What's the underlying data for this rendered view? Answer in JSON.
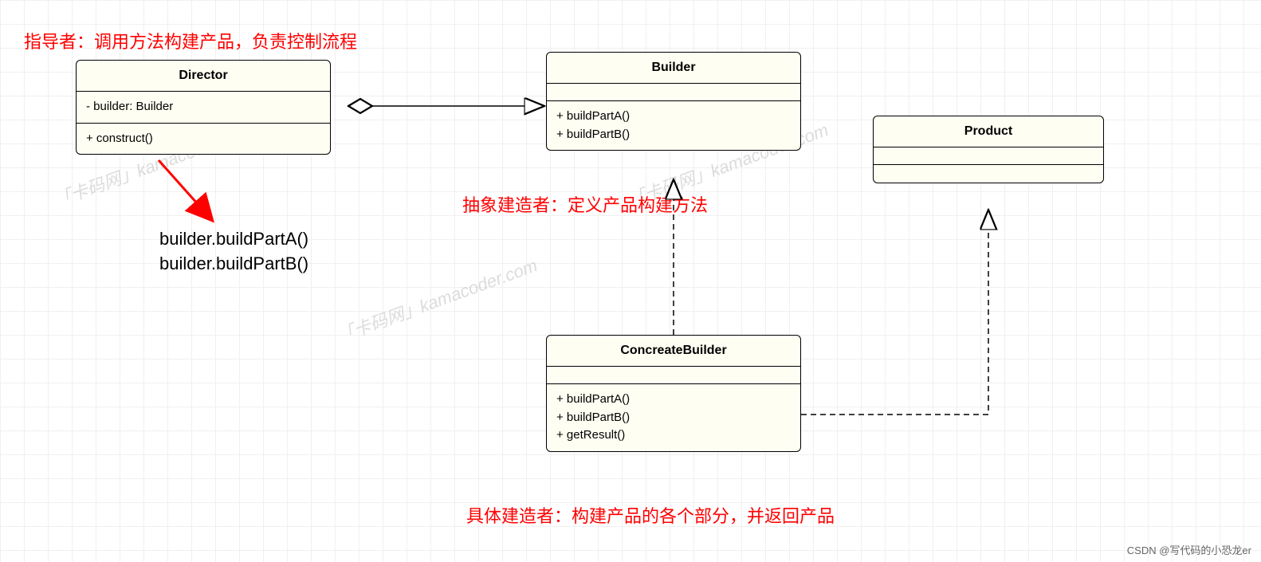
{
  "annotations": {
    "director_note": "指导者：调用方法构建产品，负责控制流程",
    "abstract_note": "抽象建造者：定义产品构建方法",
    "concrete_note": "具体建造者：构建产品的各个部分，并返回产品"
  },
  "classes": {
    "director": {
      "title": "Director",
      "attrs": "- builder: Builder",
      "ops": "+ construct()"
    },
    "builder": {
      "title": "Builder",
      "op1": "+ buildPartA()",
      "op2": "+ buildPartB()"
    },
    "product": {
      "title": "Product"
    },
    "concrete": {
      "title": "ConcreateBuilder",
      "op1": "+ buildPartA()",
      "op2": "+ buildPartB()",
      "op3": "+ getResult()"
    }
  },
  "call_note": {
    "line1": "builder.buildPartA()",
    "line2": "builder.buildPartB()"
  },
  "watermarks": {
    "w1": "「卡码网」kamacoder.com",
    "w2": "「卡码网」kamacoder.com",
    "w3": "「卡码网」kamacoder.com"
  },
  "attribution": "CSDN @写代码的小恐龙er"
}
